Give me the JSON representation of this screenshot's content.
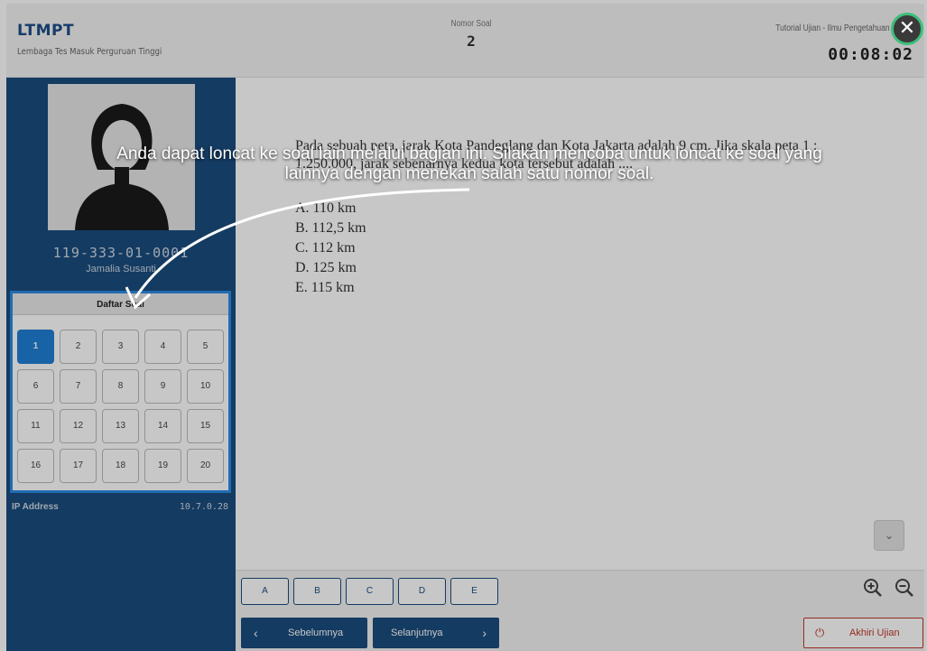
{
  "header": {
    "brand": "LTMPT",
    "brand_sub": "Lembaga Tes Masuk Perguruan Tinggi",
    "question_label": "Nomor Soal",
    "question_number": "2",
    "tutorial": "Tutorial Ujian - Ilmu Pengetahuan",
    "timer": "00:08:02",
    "close_icon": "✕"
  },
  "sidebar": {
    "reg_number": "119-333-01-0001",
    "user_name": "Jamalia Susanti",
    "daftar_title": "Daftar Soal",
    "questions": [
      "1",
      "2",
      "3",
      "4",
      "5",
      "6",
      "7",
      "8",
      "9",
      "10",
      "11",
      "12",
      "13",
      "14",
      "15",
      "16",
      "17",
      "18",
      "19",
      "20"
    ],
    "active_question": "1",
    "ip_label": "IP Address",
    "ip_value": "10.7.0.28"
  },
  "question": {
    "text": "Pada sebuah peta, jarak Kota Pandeglang dan Kota Jakarta adalah 9 cm. Jika skala peta 1 : 1.250.000, jarak sebenarnya kedua kota tersebut adalah ....",
    "options": [
      "A.  110 km",
      "B.  112,5 km",
      "C.  112 km",
      "D.  125 km",
      "E.  115 km"
    ]
  },
  "answers": [
    "A",
    "B",
    "C",
    "D",
    "E"
  ],
  "nav": {
    "prev": "Sebelumnya",
    "next": "Selanjutnya",
    "end": "Akhiri Ujian"
  },
  "overlay": {
    "tip": "Anda dapat loncat ke soal lain melalui bagian ini. Silakan mencoba untuk loncat ke soal yang lainnya dengan menekan salah satu nomor soal."
  },
  "colors": {
    "sidebar": "#1a4c7e",
    "active": "#1f7fd4",
    "highlight": "#2b8be6",
    "close_ring": "#3dbf7a"
  }
}
